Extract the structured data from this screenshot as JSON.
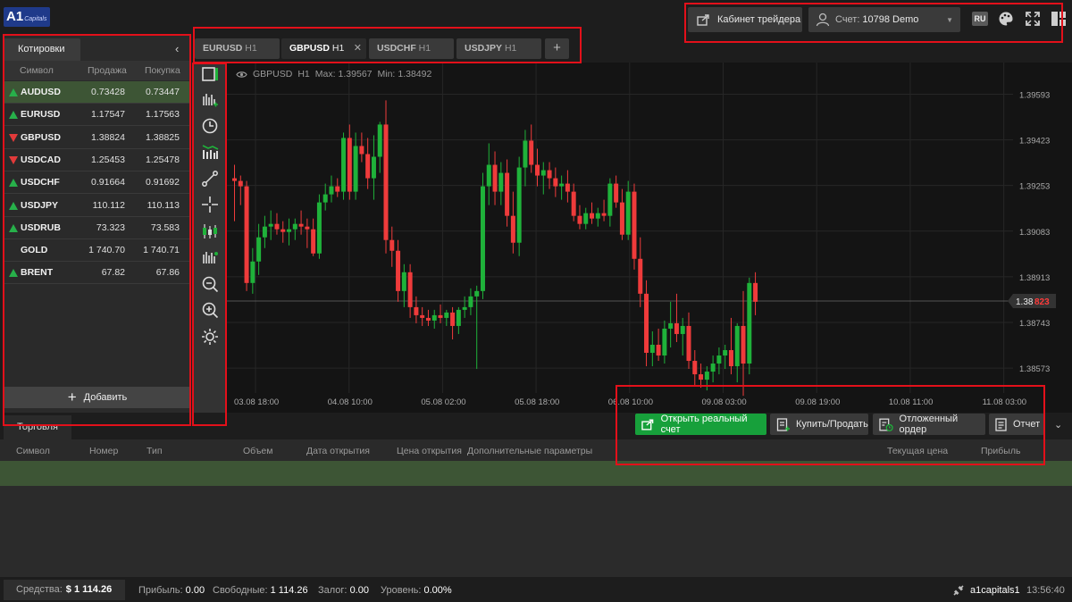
{
  "brand": {
    "logo_main": "A1",
    "logo_sub": "Capitals"
  },
  "topbar": {
    "cabinet_label": "Кабинет трейдера",
    "account_prefix": "Счет:",
    "account_value": "10798 Demo",
    "language": "RU",
    "icons": [
      "external-link-icon",
      "user-icon",
      "chevron-down-icon",
      "palette-icon",
      "fullscreen-icon",
      "layout-grid-icon"
    ]
  },
  "quotes": {
    "tab_label": "Котировки",
    "columns": {
      "symbol": "Символ",
      "bid": "Продажа",
      "ask": "Покупка"
    },
    "rows": [
      {
        "symbol": "AUDUSD",
        "bid": "0.73428",
        "ask": "0.73447",
        "dir": "up"
      },
      {
        "symbol": "EURUSD",
        "bid": "1.17547",
        "ask": "1.17563",
        "dir": "up"
      },
      {
        "symbol": "GBPUSD",
        "bid": "1.38824",
        "ask": "1.38825",
        "dir": "down"
      },
      {
        "symbol": "USDCAD",
        "bid": "1.25453",
        "ask": "1.25478",
        "dir": "down"
      },
      {
        "symbol": "USDCHF",
        "bid": "0.91664",
        "ask": "0.91692",
        "dir": "up"
      },
      {
        "symbol": "USDJPY",
        "bid": "110.112",
        "ask": "110.113",
        "dir": "up"
      },
      {
        "symbol": "USDRUB",
        "bid": "73.323",
        "ask": "73.583",
        "dir": "up"
      },
      {
        "symbol": "GOLD",
        "bid": "1 740.70",
        "ask": "1 740.71",
        "dir": "none"
      },
      {
        "symbol": "BRENT",
        "bid": "67.82",
        "ask": "67.86",
        "dir": "up"
      }
    ],
    "add_label": "Добавить"
  },
  "chart_tabs": [
    {
      "symbol": "EURUSD",
      "tf": "H1",
      "active": false
    },
    {
      "symbol": "GBPUSD",
      "tf": "H1",
      "active": true
    },
    {
      "symbol": "USDCHF",
      "tf": "H1",
      "active": false
    },
    {
      "symbol": "USDJPY",
      "tf": "H1",
      "active": false
    }
  ],
  "tools": [
    "chart-type-icon",
    "add-indicator-icon",
    "timeframe-icon",
    "volume-icon",
    "trendline-icon",
    "crosshair-icon",
    "candlestick-icon",
    "bar-chart-icon",
    "zoom-out-icon",
    "zoom-in-icon",
    "settings-icon"
  ],
  "chart_info": {
    "symbol": "GBPUSD",
    "tf": "H1",
    "max_label": "Max:",
    "max": "1.39567",
    "min_label": "Min:",
    "min": "1.38492"
  },
  "chart_data": {
    "type": "candlestick",
    "symbol": "GBPUSD",
    "timeframe": "H1",
    "y_ticks": [
      "1.39593",
      "1.39423",
      "1.39253",
      "1.39083",
      "1.38913",
      "1.38743",
      "1.38573"
    ],
    "ylim": [
      1.38497,
      1.39671
    ],
    "x_ticks": [
      "03.08 18:00",
      "04.08 10:00",
      "05.08 02:00",
      "05.08 18:00",
      "06.08 10:00",
      "09.08 03:00",
      "09.08 19:00",
      "10.08 11:00",
      "11.08 03:00"
    ],
    "current_price_main": "1.38",
    "current_price_tail": "823",
    "current_price": 1.38823,
    "candles_ohlc": [
      [
        1.3928,
        1.3933,
        1.3912,
        1.3927
      ],
      [
        1.3927,
        1.3929,
        1.3918,
        1.3925
      ],
      [
        1.3925,
        1.3927,
        1.3886,
        1.3889
      ],
      [
        1.3889,
        1.3902,
        1.3885,
        1.3897
      ],
      [
        1.3897,
        1.3911,
        1.3892,
        1.3906
      ],
      [
        1.3906,
        1.3914,
        1.3902,
        1.391
      ],
      [
        1.391,
        1.3916,
        1.3905,
        1.3911
      ],
      [
        1.3911,
        1.3915,
        1.3907,
        1.3909
      ],
      [
        1.3909,
        1.3912,
        1.3904,
        1.3908
      ],
      [
        1.3908,
        1.3913,
        1.3903,
        1.3909
      ],
      [
        1.3909,
        1.3913,
        1.3905,
        1.3911
      ],
      [
        1.3911,
        1.3916,
        1.3907,
        1.391
      ],
      [
        1.391,
        1.3913,
        1.3902,
        1.3909
      ],
      [
        1.3909,
        1.3913,
        1.3899,
        1.39
      ],
      [
        1.39,
        1.3922,
        1.3898,
        1.3919
      ],
      [
        1.3919,
        1.3926,
        1.3916,
        1.3922
      ],
      [
        1.3922,
        1.3929,
        1.3919,
        1.3925
      ],
      [
        1.3925,
        1.3928,
        1.3921,
        1.3923
      ],
      [
        1.3923,
        1.3945,
        1.392,
        1.3943
      ],
      [
        1.3943,
        1.3948,
        1.392,
        1.3923
      ],
      [
        1.3923,
        1.3945,
        1.392,
        1.394
      ],
      [
        1.394,
        1.3945,
        1.3934,
        1.3937
      ],
      [
        1.3937,
        1.3943,
        1.3924,
        1.3928
      ],
      [
        1.3928,
        1.3944,
        1.392,
        1.3936
      ],
      [
        1.3936,
        1.3949,
        1.393,
        1.3948
      ],
      [
        1.3948,
        1.3957,
        1.39,
        1.3905
      ],
      [
        1.3905,
        1.391,
        1.3895,
        1.3901
      ],
      [
        1.3901,
        1.3905,
        1.3882,
        1.3886
      ],
      [
        1.3886,
        1.3896,
        1.388,
        1.3893
      ],
      [
        1.3893,
        1.3896,
        1.3876,
        1.388
      ],
      [
        1.388,
        1.3884,
        1.3874,
        1.3877
      ],
      [
        1.3877,
        1.388,
        1.3873,
        1.3876
      ],
      [
        1.3876,
        1.3879,
        1.3873,
        1.3875
      ],
      [
        1.3875,
        1.3879,
        1.3872,
        1.3877
      ],
      [
        1.3877,
        1.3881,
        1.3874,
        1.3876
      ],
      [
        1.3876,
        1.3879,
        1.3873,
        1.3878
      ],
      [
        1.3878,
        1.388,
        1.3868,
        1.3873
      ],
      [
        1.3873,
        1.388,
        1.387,
        1.3879
      ],
      [
        1.3879,
        1.3884,
        1.3876,
        1.388
      ],
      [
        1.388,
        1.3887,
        1.3877,
        1.3884
      ],
      [
        1.3884,
        1.3888,
        1.3857,
        1.3886
      ],
      [
        1.3886,
        1.393,
        1.3883,
        1.3925
      ],
      [
        1.3925,
        1.3941,
        1.3918,
        1.3933
      ],
      [
        1.3933,
        1.3938,
        1.3918,
        1.3923
      ],
      [
        1.3923,
        1.3934,
        1.3918,
        1.393
      ],
      [
        1.393,
        1.3935,
        1.391,
        1.3914
      ],
      [
        1.3914,
        1.3923,
        1.39,
        1.3904
      ],
      [
        1.3904,
        1.3936,
        1.3899,
        1.3932
      ],
      [
        1.3932,
        1.3946,
        1.3925,
        1.3942
      ],
      [
        1.3942,
        1.3948,
        1.393,
        1.3933
      ],
      [
        1.3933,
        1.3939,
        1.3925,
        1.3929
      ],
      [
        1.3929,
        1.3934,
        1.3922,
        1.3931
      ],
      [
        1.3931,
        1.3934,
        1.3924,
        1.3928
      ],
      [
        1.3928,
        1.3932,
        1.3921,
        1.3925
      ],
      [
        1.3925,
        1.3929,
        1.392,
        1.3926
      ],
      [
        1.3926,
        1.3931,
        1.3919,
        1.3923
      ],
      [
        1.3923,
        1.3926,
        1.3912,
        1.3914
      ],
      [
        1.3914,
        1.3918,
        1.3909,
        1.3911
      ],
      [
        1.3911,
        1.3917,
        1.3909,
        1.3915
      ],
      [
        1.3915,
        1.3919,
        1.3911,
        1.3913
      ],
      [
        1.3913,
        1.3917,
        1.391,
        1.3915
      ],
      [
        1.3915,
        1.392,
        1.3912,
        1.3914
      ],
      [
        1.3914,
        1.3928,
        1.391,
        1.3926
      ],
      [
        1.3926,
        1.3929,
        1.3917,
        1.3919
      ],
      [
        1.3919,
        1.3924,
        1.3905,
        1.3907
      ],
      [
        1.3907,
        1.3927,
        1.3905,
        1.3923
      ],
      [
        1.3923,
        1.3926,
        1.3894,
        1.3898
      ],
      [
        1.3898,
        1.3906,
        1.388,
        1.3885
      ],
      [
        1.3885,
        1.389,
        1.3858,
        1.3863
      ],
      [
        1.3863,
        1.3871,
        1.3858,
        1.3866
      ],
      [
        1.3866,
        1.3872,
        1.386,
        1.3862
      ],
      [
        1.3862,
        1.3875,
        1.3859,
        1.3872
      ],
      [
        1.3872,
        1.3882,
        1.3865,
        1.3874
      ],
      [
        1.3874,
        1.3885,
        1.3867,
        1.387
      ],
      [
        1.387,
        1.3876,
        1.3862,
        1.3873
      ],
      [
        1.3873,
        1.3878,
        1.3857,
        1.386
      ],
      [
        1.386,
        1.3864,
        1.3851,
        1.3855
      ],
      [
        1.3855,
        1.3859,
        1.385,
        1.3853
      ],
      [
        1.3853,
        1.3858,
        1.3849,
        1.3856
      ],
      [
        1.3856,
        1.3862,
        1.3852,
        1.3859
      ],
      [
        1.3859,
        1.3865,
        1.3855,
        1.3862
      ],
      [
        1.3862,
        1.3866,
        1.3857,
        1.3864
      ],
      [
        1.3864,
        1.3876,
        1.3855,
        1.3858
      ],
      [
        1.3858,
        1.3874,
        1.3852,
        1.3873
      ],
      [
        1.3873,
        1.3886,
        1.3847,
        1.3859
      ],
      [
        1.3859,
        1.3891,
        1.3855,
        1.3889
      ],
      [
        1.3889,
        1.3893,
        1.3877,
        1.3882
      ]
    ]
  },
  "trade": {
    "tab_label": "Торговля",
    "buttons": {
      "open_real": "Открыть реальный счет",
      "buy_sell": "Купить/Продать",
      "pending": "Отложенный ордер",
      "report": "Отчет"
    },
    "columns": {
      "symbol": "Символ",
      "number": "Номер",
      "type": "Тип",
      "volume": "Объем",
      "open_date": "Дата открытия",
      "open_price": "Цена открытия",
      "extra": "Дополнительные параметры",
      "current_price": "Текущая цена",
      "profit": "Прибыль"
    }
  },
  "status": {
    "equity_label": "Средства:",
    "equity_value": "$ 1 114.26",
    "profit_label": "Прибыль:",
    "profit_value": "0.00",
    "free_label": "Свободные:",
    "free_value": "1 114.26",
    "margin_label": "Залог:",
    "margin_value": "0.00",
    "level_label": "Уровень:",
    "level_value": "0.00%",
    "username": "a1capitals1",
    "time": "13:56:40"
  },
  "colors": {
    "bull": "#1fb23a",
    "bear": "#ef3b3b",
    "accent_green": "#17a03b",
    "price_tag": "#333333",
    "price_tail": "#ff3b3b"
  }
}
